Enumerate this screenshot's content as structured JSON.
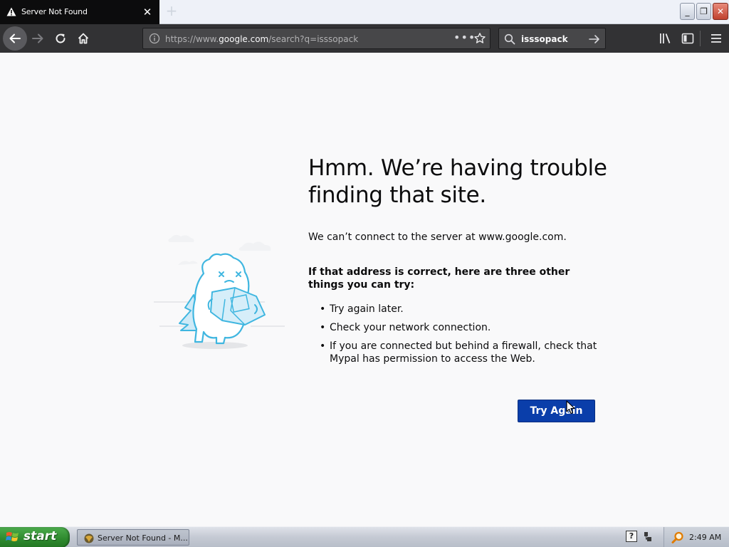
{
  "browser": {
    "tab_title": "Server Not Found",
    "tab_close": "✕",
    "new_tab": "+",
    "url_prefix": "https://www.",
    "url_domain": "google.com",
    "url_rest": "/search?q=isssopack",
    "page_actions": "•••",
    "search_query": "isssopack"
  },
  "window_controls": {
    "minimize": "_",
    "maximize": "❐",
    "close": "✕"
  },
  "error_page": {
    "title": "Hmm. We’re having trouble finding that site.",
    "description": "We can’t connect to the server at www.google.com.",
    "suggestion_heading": "If that address is correct, here are three other things you can try:",
    "suggestions": [
      "Try again later.",
      "Check your network connection.",
      "If you are connected but behind a firewall, check that Mypal has permission to access the Web."
    ],
    "try_again_label": "Try Again"
  },
  "taskbar": {
    "start_label": "start",
    "task_label": "Server Not Found - M...",
    "help_icon_glyph": "?",
    "clock": "2:49 AM"
  },
  "colors": {
    "tab_bg": "#0c0c0d",
    "toolbar_bg": "#323234",
    "page_bg": "#f9f9fa",
    "button_blue": "#0a3eaa",
    "illustration_cyan": "#3fb6e0"
  },
  "icons": [
    "warning-icon",
    "back-arrow-icon",
    "forward-arrow-icon",
    "reload-icon",
    "home-icon",
    "info-icon",
    "bookmark-star-icon",
    "search-icon",
    "go-arrow-icon",
    "library-icon",
    "sidebar-icon",
    "hamburger-menu-icon",
    "windows-flag-icon",
    "help-icon",
    "network-icon"
  ]
}
